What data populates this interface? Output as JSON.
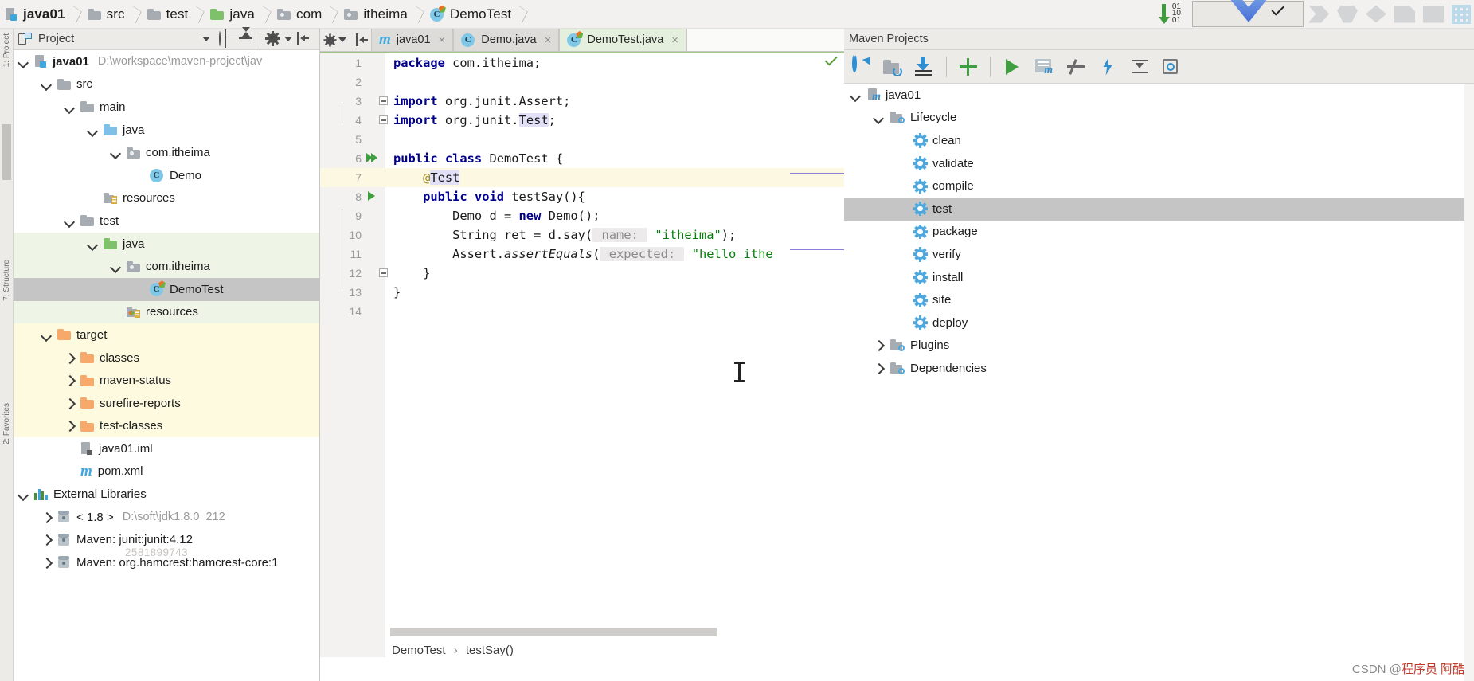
{
  "breadcrumb": [
    {
      "label": "java01",
      "icon": "module-icon",
      "bold": true
    },
    {
      "label": "src",
      "icon": "folder-icon"
    },
    {
      "label": "test",
      "icon": "folder-icon"
    },
    {
      "label": "java",
      "icon": "folder-green-icon"
    },
    {
      "label": "com",
      "icon": "package-icon"
    },
    {
      "label": "itheima",
      "icon": "package-icon"
    },
    {
      "label": "DemoTest",
      "icon": "class-test-icon"
    }
  ],
  "topbar_right": {
    "binary_digits": [
      "01",
      "10",
      "01"
    ],
    "binary_icon": "binary-download-icon",
    "run_button_icon": "checkmark-icon"
  },
  "project_panel": {
    "title": "Project",
    "icons": [
      "project-icon",
      "chevron-down-icon",
      "locate-target-icon",
      "collapse-icon",
      "gear-icon",
      "hide-panel-icon"
    ],
    "tree": [
      {
        "label": "java01",
        "path": "D:\\workspace\\maven-project\\jav",
        "indent": 0,
        "arrow": "down",
        "icon": "module-icon",
        "bold": true,
        "bg": "none"
      },
      {
        "label": "src",
        "indent": 1,
        "arrow": "down",
        "icon": "folder-icon",
        "bg": "none"
      },
      {
        "label": "main",
        "indent": 2,
        "arrow": "down",
        "icon": "folder-icon",
        "bg": "none"
      },
      {
        "label": "java",
        "indent": 3,
        "arrow": "down",
        "icon": "folder-blue-icon",
        "bg": "none"
      },
      {
        "label": "com.itheima",
        "indent": 4,
        "arrow": "down",
        "icon": "package-icon",
        "bg": "none"
      },
      {
        "label": "Demo",
        "indent": 5,
        "arrow": "none",
        "icon": "class-icon",
        "bg": "none"
      },
      {
        "label": "resources",
        "indent": 3,
        "arrow": "none",
        "icon": "resources-icon",
        "bg": "none"
      },
      {
        "label": "test",
        "indent": 2,
        "arrow": "down",
        "icon": "folder-icon",
        "bg": "none"
      },
      {
        "label": "java",
        "indent": 3,
        "arrow": "down",
        "icon": "folder-green-icon",
        "bg": "green"
      },
      {
        "label": "com.itheima",
        "indent": 4,
        "arrow": "down",
        "icon": "package-icon",
        "bg": "green"
      },
      {
        "label": "DemoTest",
        "indent": 5,
        "arrow": "none",
        "icon": "class-test-icon",
        "bg": "selected"
      },
      {
        "label": "resources",
        "indent": 4,
        "arrow": "none",
        "icon": "test-resources-icon",
        "bg": "green"
      },
      {
        "label": "target",
        "indent": 1,
        "arrow": "down",
        "icon": "folder-orange-icon",
        "bg": "yellow"
      },
      {
        "label": "classes",
        "indent": 2,
        "arrow": "right",
        "icon": "folder-orange-icon",
        "bg": "yellow"
      },
      {
        "label": "maven-status",
        "indent": 2,
        "arrow": "right",
        "icon": "folder-orange-icon",
        "bg": "yellow"
      },
      {
        "label": "surefire-reports",
        "indent": 2,
        "arrow": "right",
        "icon": "folder-orange-icon",
        "bg": "yellow"
      },
      {
        "label": "test-classes",
        "indent": 2,
        "arrow": "right",
        "icon": "folder-orange-icon",
        "bg": "yellow"
      },
      {
        "label": "java01.iml",
        "indent": 2,
        "arrow": "none",
        "icon": "iml-file-icon",
        "bg": "none"
      },
      {
        "label": "pom.xml",
        "indent": 2,
        "arrow": "none",
        "icon": "maven-m-icon",
        "bg": "none"
      },
      {
        "label": "External Libraries",
        "indent": 0,
        "arrow": "down",
        "icon": "library-icon",
        "bg": "none"
      },
      {
        "label": "< 1.8 >",
        "path": "D:\\soft\\jdk1.8.0_212",
        "indent": 1,
        "arrow": "right",
        "icon": "jar-icon",
        "bg": "none"
      },
      {
        "label": "Maven: junit:junit:4.12",
        "indent": 1,
        "arrow": "right",
        "icon": "jar-icon",
        "bg": "none"
      },
      {
        "label": "Maven: org.hamcrest:hamcrest-core:1",
        "indent": 1,
        "arrow": "right",
        "icon": "jar-icon",
        "bg": "none"
      }
    ],
    "watermark": "2581899743"
  },
  "editor": {
    "toolbar_icons": [
      "gear-dropdown-icon",
      "hide-panel-icon"
    ],
    "tabs": [
      {
        "label": "java01",
        "icon": "maven-m-icon",
        "active": false,
        "close": "×"
      },
      {
        "label": "Demo.java",
        "icon": "class-icon",
        "active": false,
        "close": "×"
      },
      {
        "label": "DemoTest.java",
        "icon": "class-test-icon",
        "active": true,
        "close": "×"
      }
    ],
    "lines": [
      {
        "n": "1",
        "gutter": "none",
        "segments": [
          {
            "t": "package",
            "c": "kw"
          },
          {
            "t": " com.itheima;",
            "c": ""
          }
        ]
      },
      {
        "n": "2",
        "gutter": "none",
        "segments": []
      },
      {
        "n": "3",
        "gutter": "fold-open",
        "segments": [
          {
            "t": "import",
            "c": "kw"
          },
          {
            "t": " org.junit.Assert;",
            "c": ""
          }
        ]
      },
      {
        "n": "4",
        "gutter": "fold-open",
        "segments": [
          {
            "t": "import",
            "c": "kw"
          },
          {
            "t": " org.junit.",
            "c": ""
          },
          {
            "t": "Test",
            "c": "hl"
          },
          {
            "t": ";",
            "c": ""
          }
        ]
      },
      {
        "n": "5",
        "gutter": "none",
        "segments": []
      },
      {
        "n": "6",
        "gutter": "run-all",
        "segments": [
          {
            "t": "public class",
            "c": "kw"
          },
          {
            "t": " DemoTest {",
            "c": ""
          }
        ]
      },
      {
        "n": "7",
        "gutter": "none",
        "caret": true,
        "segments": [
          {
            "t": "    ",
            "c": ""
          },
          {
            "t": "@",
            "c": "anno"
          },
          {
            "t": "Test",
            "c": "hl"
          }
        ]
      },
      {
        "n": "8",
        "gutter": "run-one",
        "segments": [
          {
            "t": "    ",
            "c": ""
          },
          {
            "t": "public void",
            "c": "kw"
          },
          {
            "t": " testSay(){",
            "c": ""
          }
        ]
      },
      {
        "n": "9",
        "gutter": "none",
        "segments": [
          {
            "t": "        Demo d = ",
            "c": ""
          },
          {
            "t": "new",
            "c": "kw"
          },
          {
            "t": " Demo();",
            "c": ""
          }
        ]
      },
      {
        "n": "10",
        "gutter": "none",
        "segments": [
          {
            "t": "        String ret = d.say(",
            "c": ""
          },
          {
            "t": " name: ",
            "c": "hint"
          },
          {
            "t": " \"itheima\"",
            "c": "str"
          },
          {
            "t": ");",
            "c": ""
          }
        ]
      },
      {
        "n": "11",
        "gutter": "none",
        "segments": [
          {
            "t": "        Assert.",
            "c": ""
          },
          {
            "t": "assertEquals",
            "c": "ital"
          },
          {
            "t": "(",
            "c": ""
          },
          {
            "t": " expected: ",
            "c": "hint"
          },
          {
            "t": " \"hello ithe",
            "c": "str"
          }
        ]
      },
      {
        "n": "12",
        "gutter": "fold-end",
        "segments": [
          {
            "t": "    }",
            "c": ""
          }
        ]
      },
      {
        "n": "13",
        "gutter": "none",
        "segments": [
          {
            "t": "}",
            "c": ""
          }
        ]
      },
      {
        "n": "14",
        "gutter": "none",
        "segments": []
      }
    ],
    "inspection_icon": "inspection-ok-icon",
    "bottom_breadcrumb": [
      {
        "label": "DemoTest"
      },
      {
        "label": "testSay()"
      }
    ],
    "breadcrumb_separator": "›"
  },
  "maven_panel": {
    "title": "Maven Projects",
    "toolbar_icons": [
      "reimport-icon",
      "generate-sources-icon",
      "download-sources-icon",
      "add-maven-project-icon",
      "run-goal-icon",
      "execute-maven-goal-icon",
      "toggle-skip-tests-icon",
      "toggle-offline-icon",
      "collapse-all-icon",
      "settings-icon"
    ],
    "tree": [
      {
        "label": "java01",
        "indent": 0,
        "arrow": "down",
        "icon": "maven-module-icon",
        "selected": false
      },
      {
        "label": "Lifecycle",
        "indent": 1,
        "arrow": "down",
        "icon": "lifecycle-folder-icon",
        "selected": false
      },
      {
        "label": "clean",
        "indent": 2,
        "arrow": "none",
        "icon": "goal-gear-icon",
        "selected": false
      },
      {
        "label": "validate",
        "indent": 2,
        "arrow": "none",
        "icon": "goal-gear-icon",
        "selected": false
      },
      {
        "label": "compile",
        "indent": 2,
        "arrow": "none",
        "icon": "goal-gear-icon",
        "selected": false
      },
      {
        "label": "test",
        "indent": 2,
        "arrow": "none",
        "icon": "goal-gear-icon",
        "selected": true
      },
      {
        "label": "package",
        "indent": 2,
        "arrow": "none",
        "icon": "goal-gear-icon",
        "selected": false
      },
      {
        "label": "verify",
        "indent": 2,
        "arrow": "none",
        "icon": "goal-gear-icon",
        "selected": false
      },
      {
        "label": "install",
        "indent": 2,
        "arrow": "none",
        "icon": "goal-gear-icon",
        "selected": false
      },
      {
        "label": "site",
        "indent": 2,
        "arrow": "none",
        "icon": "goal-gear-icon",
        "selected": false
      },
      {
        "label": "deploy",
        "indent": 2,
        "arrow": "none",
        "icon": "goal-gear-icon",
        "selected": false
      },
      {
        "label": "Plugins",
        "indent": 1,
        "arrow": "right",
        "icon": "lifecycle-folder-icon",
        "selected": false
      },
      {
        "label": "Dependencies",
        "indent": 1,
        "arrow": "right",
        "icon": "lifecycle-folder-icon",
        "selected": false
      }
    ]
  },
  "left_strip": {
    "items": [
      "1: Project",
      "7: Structure",
      "2: Favorites"
    ]
  },
  "watermark": {
    "prefix": "CSDN @",
    "text": "程序员 阿酷"
  },
  "colors": {
    "accent_green": "#3f9e3f",
    "accent_blue": "#4fa8dd",
    "selection": "#c5c5c5",
    "test_source_bg": "#eef5e6",
    "target_bg": "#fdfae0"
  }
}
